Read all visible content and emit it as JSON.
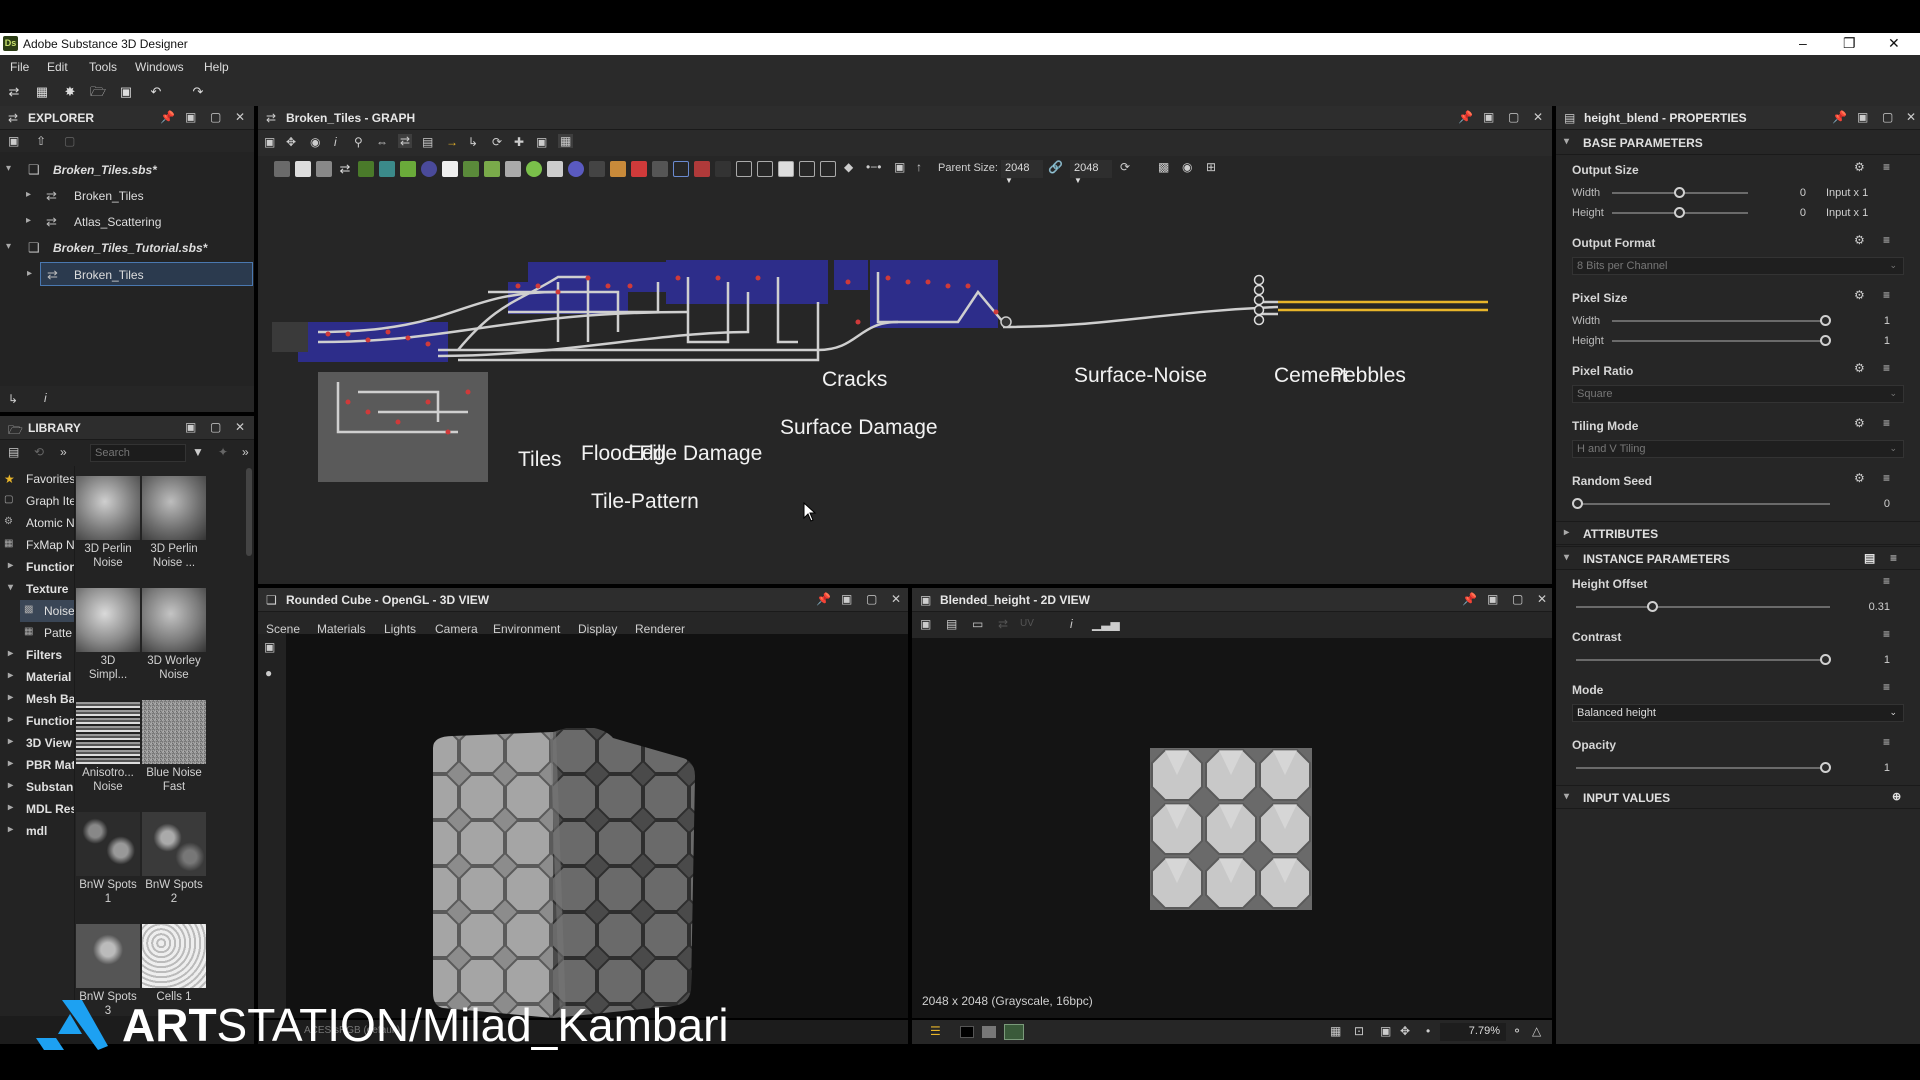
{
  "window": {
    "title": "Adobe Substance 3D Designer",
    "app_badge": "Ds"
  },
  "menu": [
    "File",
    "Edit",
    "Tools",
    "Windows",
    "Help"
  ],
  "explorer": {
    "title": "EXPLORER",
    "items": [
      {
        "label": "Broken_Tiles.sbs*",
        "level": 0
      },
      {
        "label": "Broken_Tiles",
        "level": 1
      },
      {
        "label": "Atlas_Scattering",
        "level": 1
      },
      {
        "label": "Broken_Tiles_Tutorial.sbs*",
        "level": 0
      },
      {
        "label": "Broken_Tiles",
        "level": 1
      }
    ]
  },
  "library": {
    "title": "LIBRARY",
    "search_placeholder": "Search",
    "categories": [
      "Favorites",
      "Graph Ite",
      "Atomic N",
      "FxMap N",
      "Function",
      "Texture",
      "Noise",
      "Patte",
      "Filters",
      "Material",
      "Mesh Ba",
      "Function",
      "3D View",
      "PBR Mat",
      "Substan",
      "MDL Res",
      "mdl"
    ],
    "thumbs": [
      {
        "line1": "3D Perlin",
        "line2": "Noise"
      },
      {
        "line1": "3D Perlin",
        "line2": "Noise ..."
      },
      {
        "line1": "3D",
        "line2": "Simpl..."
      },
      {
        "line1": "3D Worley",
        "line2": "Noise"
      },
      {
        "line1": "Anisotro...",
        "line2": "Noise"
      },
      {
        "line1": "Blue Noise",
        "line2": "Fast"
      },
      {
        "line1": "BnW Spots",
        "line2": "1"
      },
      {
        "line1": "BnW Spots",
        "line2": "2"
      },
      {
        "line1": "BnW Spots",
        "line2": "3"
      },
      {
        "line1": "Cells 1",
        "line2": ""
      }
    ]
  },
  "graph": {
    "title": "Broken_Tiles - GRAPH",
    "parent_size_label": "Parent Size:",
    "parent_size": "2048",
    "size_value": "2048",
    "frames": [
      "Cracks",
      "Surface-Noise",
      "Cement",
      "Pebbles",
      "Surface Damage",
      "Tiles",
      "Flood Fill",
      "Edge Damage",
      "Tile-Pattern"
    ]
  },
  "view3d": {
    "title": "Rounded Cube - OpenGL - 3D VIEW",
    "tabs": [
      "Scene",
      "Materials",
      "Lights",
      "Camera",
      "Environment",
      "Display",
      "Renderer"
    ],
    "colorspace": "ACES sRGB (default)"
  },
  "view2d": {
    "title": "Blended_height - 2D VIEW",
    "uv_label": "UV",
    "info": "2048 x 2048 (Grayscale, 16bpc)",
    "zoom": "7.79%"
  },
  "properties": {
    "title": "height_blend - PROPERTIES",
    "base_parameters": "BASE PARAMETERS",
    "output_size": {
      "label": "Output Size",
      "width_label": "Width",
      "height_label": "Height",
      "width_value": "0",
      "height_value": "0",
      "width_mode": "Input x 1",
      "height_mode": "Input x 1"
    },
    "output_format": {
      "label": "Output Format",
      "value": "8 Bits per Channel"
    },
    "pixel_size": {
      "label": "Pixel Size",
      "width_label": "Width",
      "height_label": "Height",
      "width_value": "1",
      "height_value": "1"
    },
    "pixel_ratio": {
      "label": "Pixel Ratio",
      "value": "Square"
    },
    "tiling_mode": {
      "label": "Tiling Mode",
      "value": "H and V Tiling"
    },
    "random_seed": {
      "label": "Random Seed",
      "value": "0"
    },
    "attributes": "ATTRIBUTES",
    "instance_parameters": "INSTANCE PARAMETERS",
    "height_offset": {
      "label": "Height Offset",
      "value": "0.31",
      "level": 0.31
    },
    "contrast": {
      "label": "Contrast",
      "value": "1",
      "level": 1
    },
    "mode": {
      "label": "Mode",
      "value": "Balanced height"
    },
    "opacity": {
      "label": "Opacity",
      "value": "1",
      "level": 1
    },
    "input_values": "INPUT VALUES"
  },
  "watermark": {
    "bold": "ART",
    "rest": "STATION/Milad_Kambari"
  }
}
